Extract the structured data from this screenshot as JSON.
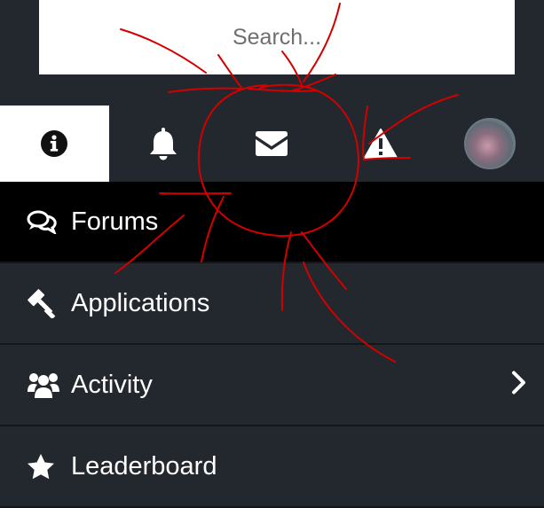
{
  "search": {
    "placeholder": "Search..."
  },
  "tabs": [
    {
      "name": "info",
      "icon": "info-icon",
      "active": true
    },
    {
      "name": "notifications",
      "icon": "bell-icon",
      "active": false
    },
    {
      "name": "messages",
      "icon": "envelope-icon",
      "active": false
    },
    {
      "name": "alerts",
      "icon": "warning-icon",
      "active": false
    },
    {
      "name": "profile",
      "icon": "avatar",
      "active": false
    }
  ],
  "menu": {
    "items": [
      {
        "label": "Forums",
        "icon": "comments-icon",
        "active": true
      },
      {
        "label": "Applications",
        "icon": "gavel-icon",
        "active": false
      },
      {
        "label": "Activity",
        "icon": "users-icon",
        "active": false,
        "has_submenu": true
      },
      {
        "label": "Leaderboard",
        "icon": "star-icon",
        "active": false
      }
    ]
  },
  "colors": {
    "background": "#23272e",
    "active_item": "#000000",
    "active_tab": "#ffffff",
    "annotation": "#d40000"
  }
}
